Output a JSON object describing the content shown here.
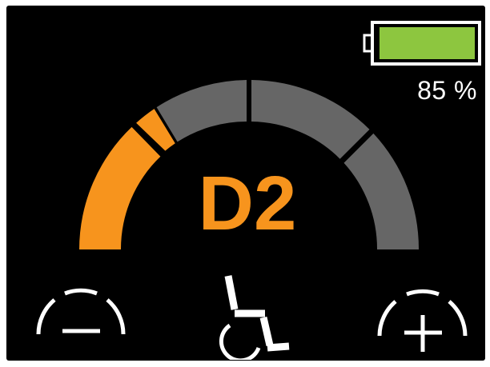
{
  "battery": {
    "level_percent": 85,
    "label": "85 %",
    "fill_color": "#8dc63f",
    "outline_color": "#ffffff"
  },
  "speed_gauge": {
    "segments_total": 4,
    "active_color": "#f7941d",
    "inactive_color": "#666666",
    "level_fraction": 0.23
  },
  "drive_profile": {
    "label": "D2",
    "color": "#f7941d"
  },
  "controls": {
    "decrease_icon": "minus-in-arc-icon",
    "increase_icon": "plus-in-arc-icon",
    "mode_icon": "wheelchair-icon"
  }
}
